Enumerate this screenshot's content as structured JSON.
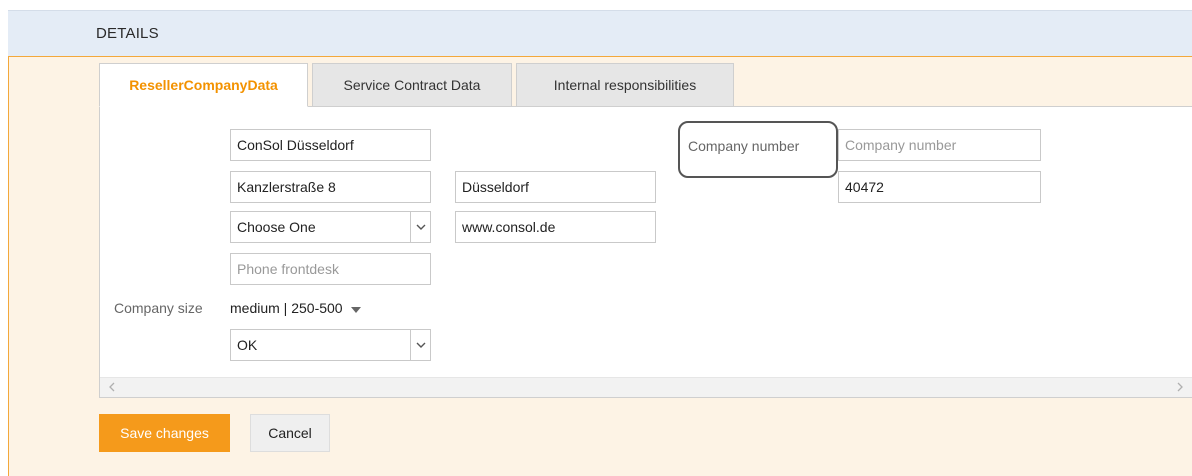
{
  "header": {
    "title": "DETAILS"
  },
  "tabs": [
    {
      "label": "ResellerCompanyData",
      "active": true
    },
    {
      "label": "Service Contract Data",
      "active": false
    },
    {
      "label": "Internal responsibilities",
      "active": false
    }
  ],
  "form": {
    "company_name": {
      "value": "ConSol Düsseldorf"
    },
    "street": {
      "value": "Kanzlerstraße 8"
    },
    "city": {
      "value": "Düsseldorf"
    },
    "country_select": {
      "value": "Choose One"
    },
    "website": {
      "value": "www.consol.de"
    },
    "phone": {
      "placeholder": "Phone frontdesk"
    },
    "company_number": {
      "label": "Company number",
      "placeholder": "Company number"
    },
    "zip": {
      "value": "40472"
    },
    "company_size": {
      "label": "Company size",
      "value": "medium | 250-500"
    },
    "status_select": {
      "value": "OK"
    }
  },
  "actions": {
    "save_label": "Save changes",
    "cancel_label": "Cancel"
  },
  "colors": {
    "accent": "#f39200",
    "save_button": "#f59a1b",
    "panel_border": "#f3a83b",
    "header_bg": "#e4ecf6"
  },
  "icons": {
    "dropdown": "chevron-down-icon",
    "scroll_left": "chevron-left-icon",
    "scroll_right": "chevron-right-icon"
  }
}
